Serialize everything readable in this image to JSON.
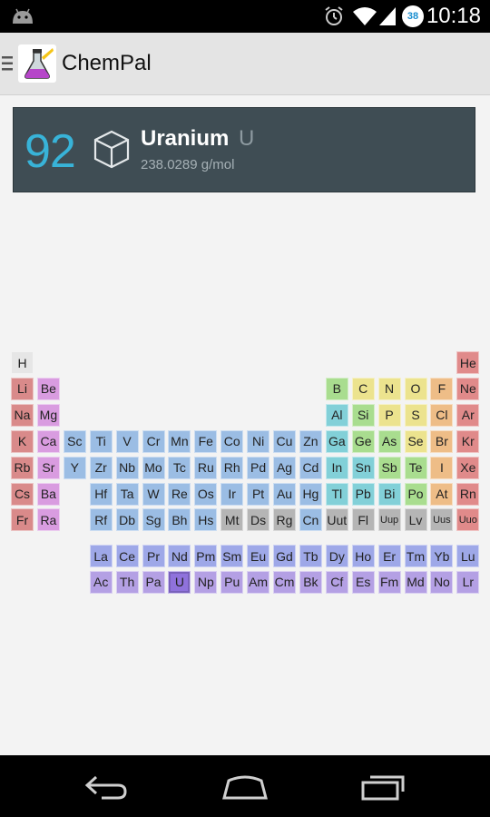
{
  "status_bar": {
    "time": "10:18",
    "battery_level": "38",
    "icons": [
      "android-icon",
      "alarm-icon",
      "wifi-icon",
      "cell-signal-icon",
      "battery-icon"
    ]
  },
  "app": {
    "title": "ChemPal",
    "logo_icon": "flask-icon",
    "menu_icon": "drawer-menu-icon"
  },
  "selected_element": {
    "atomic_number": "92",
    "name": "Uranium",
    "symbol": "U",
    "mass": "238.0289 g/mol",
    "icon": "cube-icon"
  },
  "colors": {
    "accent": "#38b3d8",
    "card_bg": "#3f4d54",
    "hydrogen": "#e6e6e6",
    "alkali": "#d98a8a",
    "alkaline_earth": "#d99ce0",
    "transition": "#9bbde4",
    "post_transition": "#82d0d8",
    "metalloid": "#a9dd8f",
    "nonmetal": "#ece38e",
    "halogen": "#eebd87",
    "noble_gas": "#e08a8a",
    "lanthanide": "#9ea8e8",
    "actinide": "#b4a0e4",
    "unknown": "#b5b5b5"
  },
  "elements": [
    {
      "s": "H",
      "r": 1,
      "c": 1,
      "cat": "hydrogen"
    },
    {
      "s": "He",
      "r": 1,
      "c": 18,
      "cat": "noble_gas"
    },
    {
      "s": "Li",
      "r": 2,
      "c": 1,
      "cat": "alkali"
    },
    {
      "s": "Be",
      "r": 2,
      "c": 2,
      "cat": "alkaline_earth"
    },
    {
      "s": "B",
      "r": 2,
      "c": 13,
      "cat": "metalloid"
    },
    {
      "s": "C",
      "r": 2,
      "c": 14,
      "cat": "nonmetal"
    },
    {
      "s": "N",
      "r": 2,
      "c": 15,
      "cat": "nonmetal"
    },
    {
      "s": "O",
      "r": 2,
      "c": 16,
      "cat": "nonmetal"
    },
    {
      "s": "F",
      "r": 2,
      "c": 17,
      "cat": "halogen"
    },
    {
      "s": "Ne",
      "r": 2,
      "c": 18,
      "cat": "noble_gas"
    },
    {
      "s": "Na",
      "r": 3,
      "c": 1,
      "cat": "alkali"
    },
    {
      "s": "Mg",
      "r": 3,
      "c": 2,
      "cat": "alkaline_earth"
    },
    {
      "s": "Al",
      "r": 3,
      "c": 13,
      "cat": "post_transition"
    },
    {
      "s": "Si",
      "r": 3,
      "c": 14,
      "cat": "metalloid"
    },
    {
      "s": "P",
      "r": 3,
      "c": 15,
      "cat": "nonmetal"
    },
    {
      "s": "S",
      "r": 3,
      "c": 16,
      "cat": "nonmetal"
    },
    {
      "s": "Cl",
      "r": 3,
      "c": 17,
      "cat": "halogen"
    },
    {
      "s": "Ar",
      "r": 3,
      "c": 18,
      "cat": "noble_gas"
    },
    {
      "s": "K",
      "r": 4,
      "c": 1,
      "cat": "alkali"
    },
    {
      "s": "Ca",
      "r": 4,
      "c": 2,
      "cat": "alkaline_earth"
    },
    {
      "s": "Sc",
      "r": 4,
      "c": 3,
      "cat": "transition"
    },
    {
      "s": "Ti",
      "r": 4,
      "c": 4,
      "cat": "transition"
    },
    {
      "s": "V",
      "r": 4,
      "c": 5,
      "cat": "transition"
    },
    {
      "s": "Cr",
      "r": 4,
      "c": 6,
      "cat": "transition"
    },
    {
      "s": "Mn",
      "r": 4,
      "c": 7,
      "cat": "transition"
    },
    {
      "s": "Fe",
      "r": 4,
      "c": 8,
      "cat": "transition"
    },
    {
      "s": "Co",
      "r": 4,
      "c": 9,
      "cat": "transition"
    },
    {
      "s": "Ni",
      "r": 4,
      "c": 10,
      "cat": "transition"
    },
    {
      "s": "Cu",
      "r": 4,
      "c": 11,
      "cat": "transition"
    },
    {
      "s": "Zn",
      "r": 4,
      "c": 12,
      "cat": "transition"
    },
    {
      "s": "Ga",
      "r": 4,
      "c": 13,
      "cat": "post_transition"
    },
    {
      "s": "Ge",
      "r": 4,
      "c": 14,
      "cat": "metalloid"
    },
    {
      "s": "As",
      "r": 4,
      "c": 15,
      "cat": "metalloid"
    },
    {
      "s": "Se",
      "r": 4,
      "c": 16,
      "cat": "nonmetal"
    },
    {
      "s": "Br",
      "r": 4,
      "c": 17,
      "cat": "halogen"
    },
    {
      "s": "Kr",
      "r": 4,
      "c": 18,
      "cat": "noble_gas"
    },
    {
      "s": "Rb",
      "r": 5,
      "c": 1,
      "cat": "alkali"
    },
    {
      "s": "Sr",
      "r": 5,
      "c": 2,
      "cat": "alkaline_earth"
    },
    {
      "s": "Y",
      "r": 5,
      "c": 3,
      "cat": "transition"
    },
    {
      "s": "Zr",
      "r": 5,
      "c": 4,
      "cat": "transition"
    },
    {
      "s": "Nb",
      "r": 5,
      "c": 5,
      "cat": "transition"
    },
    {
      "s": "Mo",
      "r": 5,
      "c": 6,
      "cat": "transition"
    },
    {
      "s": "Tc",
      "r": 5,
      "c": 7,
      "cat": "transition"
    },
    {
      "s": "Ru",
      "r": 5,
      "c": 8,
      "cat": "transition"
    },
    {
      "s": "Rh",
      "r": 5,
      "c": 9,
      "cat": "transition"
    },
    {
      "s": "Pd",
      "r": 5,
      "c": 10,
      "cat": "transition"
    },
    {
      "s": "Ag",
      "r": 5,
      "c": 11,
      "cat": "transition"
    },
    {
      "s": "Cd",
      "r": 5,
      "c": 12,
      "cat": "transition"
    },
    {
      "s": "In",
      "r": 5,
      "c": 13,
      "cat": "post_transition"
    },
    {
      "s": "Sn",
      "r": 5,
      "c": 14,
      "cat": "post_transition"
    },
    {
      "s": "Sb",
      "r": 5,
      "c": 15,
      "cat": "metalloid"
    },
    {
      "s": "Te",
      "r": 5,
      "c": 16,
      "cat": "metalloid"
    },
    {
      "s": "I",
      "r": 5,
      "c": 17,
      "cat": "halogen"
    },
    {
      "s": "Xe",
      "r": 5,
      "c": 18,
      "cat": "noble_gas"
    },
    {
      "s": "Cs",
      "r": 6,
      "c": 1,
      "cat": "alkali"
    },
    {
      "s": "Ba",
      "r": 6,
      "c": 2,
      "cat": "alkaline_earth"
    },
    {
      "s": "Hf",
      "r": 6,
      "c": 4,
      "cat": "transition"
    },
    {
      "s": "Ta",
      "r": 6,
      "c": 5,
      "cat": "transition"
    },
    {
      "s": "W",
      "r": 6,
      "c": 6,
      "cat": "transition"
    },
    {
      "s": "Re",
      "r": 6,
      "c": 7,
      "cat": "transition"
    },
    {
      "s": "Os",
      "r": 6,
      "c": 8,
      "cat": "transition"
    },
    {
      "s": "Ir",
      "r": 6,
      "c": 9,
      "cat": "transition"
    },
    {
      "s": "Pt",
      "r": 6,
      "c": 10,
      "cat": "transition"
    },
    {
      "s": "Au",
      "r": 6,
      "c": 11,
      "cat": "transition"
    },
    {
      "s": "Hg",
      "r": 6,
      "c": 12,
      "cat": "transition"
    },
    {
      "s": "Tl",
      "r": 6,
      "c": 13,
      "cat": "post_transition"
    },
    {
      "s": "Pb",
      "r": 6,
      "c": 14,
      "cat": "post_transition"
    },
    {
      "s": "Bi",
      "r": 6,
      "c": 15,
      "cat": "post_transition"
    },
    {
      "s": "Po",
      "r": 6,
      "c": 16,
      "cat": "metalloid"
    },
    {
      "s": "At",
      "r": 6,
      "c": 17,
      "cat": "halogen"
    },
    {
      "s": "Rn",
      "r": 6,
      "c": 18,
      "cat": "noble_gas"
    },
    {
      "s": "Fr",
      "r": 7,
      "c": 1,
      "cat": "alkali"
    },
    {
      "s": "Ra",
      "r": 7,
      "c": 2,
      "cat": "alkaline_earth"
    },
    {
      "s": "Rf",
      "r": 7,
      "c": 4,
      "cat": "transition"
    },
    {
      "s": "Db",
      "r": 7,
      "c": 5,
      "cat": "transition"
    },
    {
      "s": "Sg",
      "r": 7,
      "c": 6,
      "cat": "transition"
    },
    {
      "s": "Bh",
      "r": 7,
      "c": 7,
      "cat": "transition"
    },
    {
      "s": "Hs",
      "r": 7,
      "c": 8,
      "cat": "transition"
    },
    {
      "s": "Mt",
      "r": 7,
      "c": 9,
      "cat": "unknown"
    },
    {
      "s": "Ds",
      "r": 7,
      "c": 10,
      "cat": "unknown"
    },
    {
      "s": "Rg",
      "r": 7,
      "c": 11,
      "cat": "unknown"
    },
    {
      "s": "Cn",
      "r": 7,
      "c": 12,
      "cat": "transition"
    },
    {
      "s": "Uut",
      "r": 7,
      "c": 13,
      "cat": "unknown"
    },
    {
      "s": "Fl",
      "r": 7,
      "c": 14,
      "cat": "unknown"
    },
    {
      "s": "Uup",
      "r": 7,
      "c": 15,
      "cat": "unknown",
      "small": true
    },
    {
      "s": "Lv",
      "r": 7,
      "c": 16,
      "cat": "unknown"
    },
    {
      "s": "Uus",
      "r": 7,
      "c": 17,
      "cat": "unknown",
      "small": true
    },
    {
      "s": "Uuo",
      "r": 7,
      "c": 18,
      "cat": "noble_gas",
      "small": true
    },
    {
      "s": "La",
      "r": 9,
      "c": 4,
      "cat": "lanthanide"
    },
    {
      "s": "Ce",
      "r": 9,
      "c": 5,
      "cat": "lanthanide"
    },
    {
      "s": "Pr",
      "r": 9,
      "c": 6,
      "cat": "lanthanide"
    },
    {
      "s": "Nd",
      "r": 9,
      "c": 7,
      "cat": "lanthanide"
    },
    {
      "s": "Pm",
      "r": 9,
      "c": 8,
      "cat": "lanthanide"
    },
    {
      "s": "Sm",
      "r": 9,
      "c": 9,
      "cat": "lanthanide"
    },
    {
      "s": "Eu",
      "r": 9,
      "c": 10,
      "cat": "lanthanide"
    },
    {
      "s": "Gd",
      "r": 9,
      "c": 11,
      "cat": "lanthanide"
    },
    {
      "s": "Tb",
      "r": 9,
      "c": 12,
      "cat": "lanthanide"
    },
    {
      "s": "Dy",
      "r": 9,
      "c": 13,
      "cat": "lanthanide"
    },
    {
      "s": "Ho",
      "r": 9,
      "c": 14,
      "cat": "lanthanide"
    },
    {
      "s": "Er",
      "r": 9,
      "c": 15,
      "cat": "lanthanide"
    },
    {
      "s": "Tm",
      "r": 9,
      "c": 16,
      "cat": "lanthanide"
    },
    {
      "s": "Yb",
      "r": 9,
      "c": 17,
      "cat": "lanthanide"
    },
    {
      "s": "Lu",
      "r": 9,
      "c": 18,
      "cat": "lanthanide"
    },
    {
      "s": "Ac",
      "r": 10,
      "c": 4,
      "cat": "actinide"
    },
    {
      "s": "Th",
      "r": 10,
      "c": 5,
      "cat": "actinide"
    },
    {
      "s": "Pa",
      "r": 10,
      "c": 6,
      "cat": "actinide"
    },
    {
      "s": "U",
      "r": 10,
      "c": 7,
      "cat": "actinide",
      "selected": true
    },
    {
      "s": "Np",
      "r": 10,
      "c": 8,
      "cat": "actinide"
    },
    {
      "s": "Pu",
      "r": 10,
      "c": 9,
      "cat": "actinide"
    },
    {
      "s": "Am",
      "r": 10,
      "c": 10,
      "cat": "actinide"
    },
    {
      "s": "Cm",
      "r": 10,
      "c": 11,
      "cat": "actinide"
    },
    {
      "s": "Bk",
      "r": 10,
      "c": 12,
      "cat": "actinide"
    },
    {
      "s": "Cf",
      "r": 10,
      "c": 13,
      "cat": "actinide"
    },
    {
      "s": "Es",
      "r": 10,
      "c": 14,
      "cat": "actinide"
    },
    {
      "s": "Fm",
      "r": 10,
      "c": 15,
      "cat": "actinide"
    },
    {
      "s": "Md",
      "r": 10,
      "c": 16,
      "cat": "actinide"
    },
    {
      "s": "No",
      "r": 10,
      "c": 17,
      "cat": "actinide"
    },
    {
      "s": "Lr",
      "r": 10,
      "c": 18,
      "cat": "actinide"
    }
  ],
  "nav_bar": {
    "buttons": [
      "back-icon",
      "home-icon",
      "recent-apps-icon"
    ]
  }
}
